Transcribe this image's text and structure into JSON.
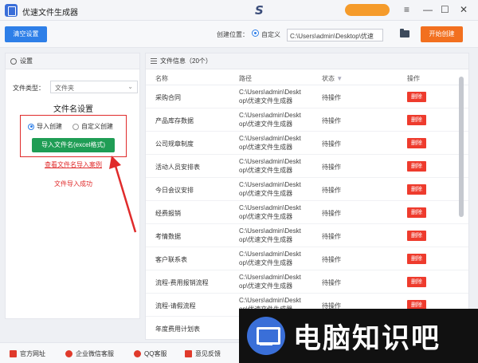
{
  "titlebar": {
    "title": "优速文件生成器",
    "brand_mark": "S",
    "minimize": "—",
    "maximize": "☐",
    "close": "✕",
    "menu": "≡"
  },
  "toolbar": {
    "clear_label": "清空设置",
    "create_position_label": "创建位置：",
    "custom_option_label": "自定义",
    "path_value": "C:\\Users\\admin\\Desktop\\优速",
    "start_label": "开始创建"
  },
  "settings": {
    "header": "设置",
    "file_type_label": "文件类型：",
    "file_type_value": "文件夹",
    "naming_title": "文件名设置",
    "option_import": "导入创建",
    "option_custom": "自定义创建",
    "import_button": "导入文件名(excel格式)",
    "view_example": "查看文件名导入案例",
    "import_status": "文件导入成功"
  },
  "fileinfo": {
    "header": "文件信息（20个）",
    "columns": {
      "name": "名称",
      "path": "路径",
      "status": "状态",
      "action": "操作"
    },
    "path_line1": "C:\\Users\\admin\\Deskt",
    "path_line2": "op\\优速文件生成器",
    "status_text": "待操作",
    "delete_label": "删除",
    "rows": [
      {
        "name": "采购合同"
      },
      {
        "name": "产品库存数据"
      },
      {
        "name": "公司规章制度"
      },
      {
        "name": "活动人员安排表"
      },
      {
        "name": "今日会议安排"
      },
      {
        "name": "经费报销"
      },
      {
        "name": "考情数据"
      },
      {
        "name": "客户联系表"
      },
      {
        "name": "流程-费用报销流程"
      },
      {
        "name": "流程-请假流程"
      },
      {
        "name": "年度费用计划表"
      }
    ]
  },
  "footer": {
    "official_site": "官方网址",
    "wechat": "企业微信客服",
    "qq": "QQ客服",
    "feedback": "意见反馈"
  },
  "watermark": {
    "text": "电脑知识吧"
  },
  "colors": {
    "primary": "#2e7fe8",
    "start": "#f2701f",
    "import": "#1f9d55",
    "delete": "#ee3b2d",
    "highlight": "#e02b2b"
  }
}
